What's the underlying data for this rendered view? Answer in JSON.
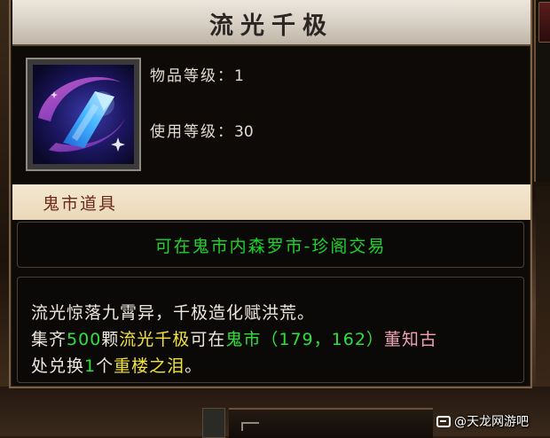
{
  "tooltip": {
    "title": "流光千极",
    "icon": "crystal-shard-item-icon",
    "item_level_label": "物品等级：",
    "item_level_value": "1",
    "use_level_label": "使用等级：",
    "use_level_value": "30",
    "category": "鬼市道具",
    "trade_note": "可在鬼市内森罗市-珍阁交易",
    "description": {
      "line1": "流光惊落九霄异，千极造化赋洪荒。",
      "line2": {
        "p1": "集齐",
        "count": "500",
        "p2": "颗",
        "item_name": "流光千极",
        "p3": "可在",
        "place": "鬼市",
        "coords_open": "（",
        "coord_x": "179",
        "coord_sep": "，",
        "coord_y": "162",
        "coords_close": "）",
        "npc": "董知古"
      },
      "line3": {
        "p1": "处兑换",
        "qty": "1",
        "p2": "个",
        "reward": "重楼之泪",
        "p3": "。"
      }
    },
    "colors": {
      "title_bar": "#d6cec2",
      "category_bar": "#f0e2c8",
      "green": "#2ee03a",
      "yellow": "#f2e23a",
      "pink": "#f0a0b4"
    }
  },
  "watermark": {
    "text": "@天龙网游吧"
  }
}
